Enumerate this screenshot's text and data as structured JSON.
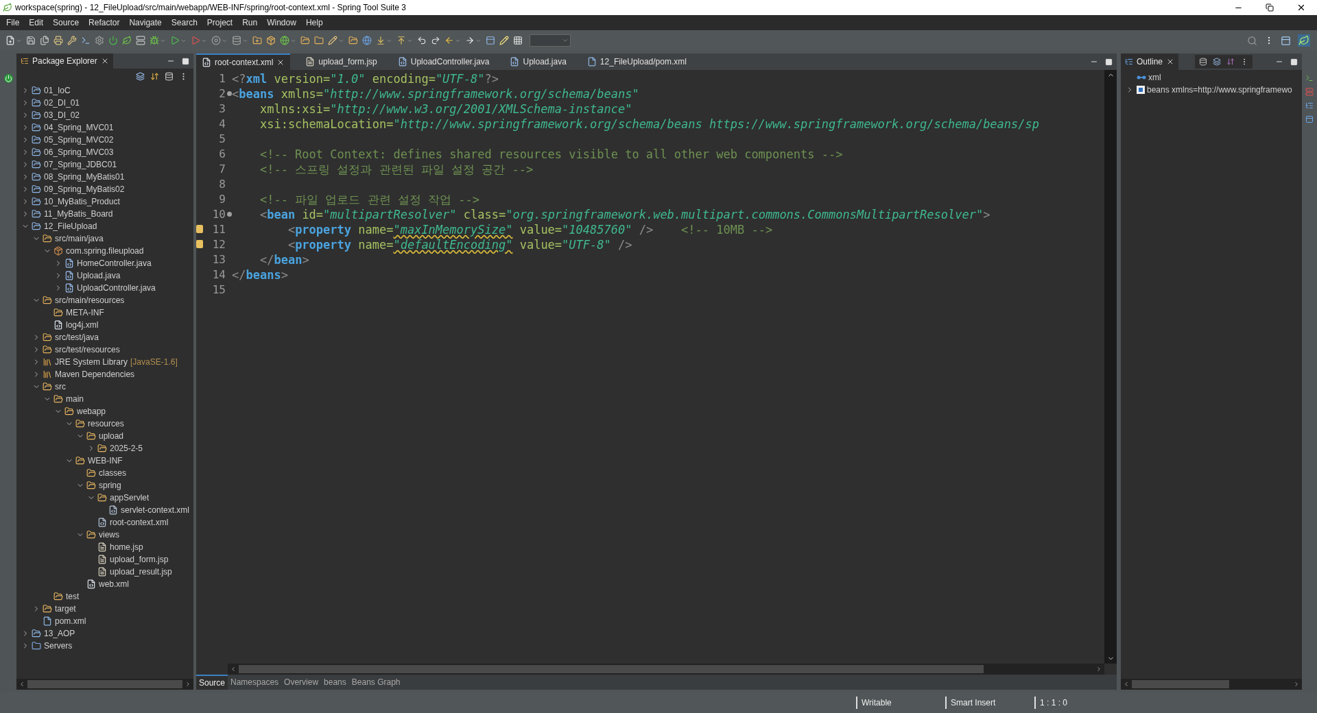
{
  "window": {
    "title": "workspace(spring) - 12_FileUpload/src/main/webapp/WEB-INF/spring/root-context.xml - Spring Tool Suite 3"
  },
  "menu": [
    "File",
    "Edit",
    "Source",
    "Refactor",
    "Navigate",
    "Search",
    "Project",
    "Run",
    "Window",
    "Help"
  ],
  "package_explorer": {
    "title": "Package Explorer",
    "tree": [
      {
        "label": "01_IoC",
        "kind": "project",
        "expanded": false
      },
      {
        "label": "02_DI_01",
        "kind": "project",
        "expanded": false
      },
      {
        "label": "03_DI_02",
        "kind": "project",
        "expanded": false
      },
      {
        "label": "04_Spring_MVC01",
        "kind": "project",
        "expanded": false
      },
      {
        "label": "05_Spring_MVC02",
        "kind": "project",
        "expanded": false
      },
      {
        "label": "06_Spring_MVC03",
        "kind": "project",
        "expanded": false
      },
      {
        "label": "07_Spring_JDBC01",
        "kind": "project",
        "expanded": false
      },
      {
        "label": "08_Spring_MyBatis01",
        "kind": "project",
        "expanded": false
      },
      {
        "label": "09_Spring_MyBatis02",
        "kind": "project",
        "expanded": false
      },
      {
        "label": "10_MyBatis_Product",
        "kind": "project",
        "expanded": false
      },
      {
        "label": "11_MyBatis_Board",
        "kind": "project",
        "expanded": false
      },
      {
        "label": "12_FileUpload",
        "kind": "project",
        "expanded": true,
        "children": [
          {
            "label": "src/main/java",
            "kind": "srcfolder",
            "expanded": true,
            "children": [
              {
                "label": "com.spring.fileupload",
                "kind": "package",
                "expanded": true,
                "children": [
                  {
                    "label": "HomeController.java",
                    "kind": "java",
                    "expanded": false
                  },
                  {
                    "label": "Upload.java",
                    "kind": "java",
                    "expanded": false
                  },
                  {
                    "label": "UploadController.java",
                    "kind": "java",
                    "expanded": false
                  }
                ]
              }
            ]
          },
          {
            "label": "src/main/resources",
            "kind": "srcfolder",
            "expanded": true,
            "children": [
              {
                "label": "META-INF",
                "kind": "folder"
              },
              {
                "label": "log4j.xml",
                "kind": "xml"
              }
            ]
          },
          {
            "label": "src/test/java",
            "kind": "srcfolder",
            "expanded": false
          },
          {
            "label": "src/test/resources",
            "kind": "srcfolder",
            "expanded": false
          },
          {
            "label": "JRE System Library",
            "suffix": "[JavaSE-1.6]",
            "kind": "library",
            "expanded": false
          },
          {
            "label": "Maven Dependencies",
            "kind": "library",
            "expanded": false
          },
          {
            "label": "src",
            "kind": "folder",
            "expanded": true,
            "children": [
              {
                "label": "main",
                "kind": "folder",
                "expanded": true,
                "children": [
                  {
                    "label": "webapp",
                    "kind": "folder",
                    "expanded": true,
                    "children": [
                      {
                        "label": "resources",
                        "kind": "folder",
                        "expanded": true,
                        "children": [
                          {
                            "label": "upload",
                            "kind": "folder",
                            "expanded": true,
                            "children": [
                              {
                                "label": "2025-2-5",
                                "kind": "folder",
                                "expanded": false
                              }
                            ]
                          }
                        ]
                      },
                      {
                        "label": "WEB-INF",
                        "kind": "folder",
                        "expanded": true,
                        "children": [
                          {
                            "label": "classes",
                            "kind": "folder"
                          },
                          {
                            "label": "spring",
                            "kind": "folder",
                            "expanded": true,
                            "children": [
                              {
                                "label": "appServlet",
                                "kind": "folder",
                                "expanded": true,
                                "children": [
                                  {
                                    "label": "servlet-context.xml",
                                    "kind": "springxml"
                                  }
                                ]
                              },
                              {
                                "label": "root-context.xml",
                                "kind": "springxml"
                              }
                            ]
                          },
                          {
                            "label": "views",
                            "kind": "folder",
                            "expanded": true,
                            "children": [
                              {
                                "label": "home.jsp",
                                "kind": "jsp"
                              },
                              {
                                "label": "upload_form.jsp",
                                "kind": "jsp"
                              },
                              {
                                "label": "upload_result.jsp",
                                "kind": "jsp"
                              }
                            ]
                          },
                          {
                            "label": "web.xml",
                            "kind": "xml"
                          }
                        ]
                      }
                    ]
                  }
                ]
              },
              {
                "label": "test",
                "kind": "folder"
              }
            ]
          },
          {
            "label": "target",
            "kind": "folder",
            "expanded": false
          },
          {
            "label": "pom.xml",
            "kind": "pom"
          }
        ]
      },
      {
        "label": "13_AOP",
        "kind": "project",
        "expanded": false
      },
      {
        "label": "Servers",
        "kind": "servers",
        "expanded": false
      }
    ]
  },
  "editor": {
    "tabs": [
      {
        "label": "root-context.xml",
        "kind": "xml",
        "selected": true
      },
      {
        "label": "upload_form.jsp",
        "kind": "jsp",
        "selected": false
      },
      {
        "label": "UploadController.java",
        "kind": "java",
        "selected": false
      },
      {
        "label": "Upload.java",
        "kind": "java",
        "selected": false
      },
      {
        "label": "12_FileUpload/pom.xml",
        "kind": "pom",
        "selected": false
      }
    ],
    "lines": [
      {
        "number": "1",
        "kind": "plain",
        "tokens": [
          {
            "kind": "punct",
            "text": "<?"
          },
          {
            "kind": "tag",
            "text": "xml"
          },
          {
            "kind": "attr",
            "text": " version="
          },
          {
            "kind": "value",
            "text": "\"1.0\""
          },
          {
            "kind": "attr",
            "text": " encoding="
          },
          {
            "kind": "value",
            "text": "\"UTF-8\""
          },
          {
            "kind": "punct",
            "text": "?>"
          }
        ]
      },
      {
        "number": "2",
        "kind": "fold",
        "tokens": [
          {
            "kind": "punct",
            "text": "<"
          },
          {
            "kind": "tag",
            "text": "beans"
          },
          {
            "kind": "attr",
            "text": " xmlns="
          },
          {
            "kind": "value",
            "text": "\"http://www.springframework.org/schema/beans\""
          }
        ]
      },
      {
        "number": "3",
        "kind": "plain",
        "tokens": [
          {
            "kind": "attr",
            "text": "    xmlns:xsi="
          },
          {
            "kind": "value",
            "text": "\"http://www.w3.org/2001/XMLSchema-instance\""
          }
        ]
      },
      {
        "number": "4",
        "kind": "plain",
        "tokens": [
          {
            "kind": "attr",
            "text": "    xsi:schemaLocation="
          },
          {
            "kind": "value",
            "text": "\"http://www.springframework.org/schema/beans https://www.springframework.org/schema/beans/sp"
          }
        ]
      },
      {
        "number": "5",
        "kind": "plain"
      },
      {
        "number": "6",
        "kind": "plain",
        "tokens": [
          {
            "kind": "comment",
            "text": "    <!-- Root Context: defines shared resources visible to all other web components -->"
          }
        ]
      },
      {
        "number": "7",
        "kind": "plain",
        "tokens": [
          {
            "kind": "comment",
            "text": "    <!-- 스프링 설정과 관련된 파일 설정 공간 -->"
          }
        ]
      },
      {
        "number": "8",
        "kind": "plain"
      },
      {
        "number": "9",
        "kind": "plain",
        "tokens": [
          {
            "kind": "comment",
            "text": "    <!-- 파일 업로드 관련 설정 작업 -->"
          }
        ]
      },
      {
        "number": "10",
        "kind": "fold",
        "tokens": [
          {
            "kind": "punct",
            "text": "    <"
          },
          {
            "kind": "tag",
            "text": "bean"
          },
          {
            "kind": "attr",
            "text": " id="
          },
          {
            "kind": "value",
            "text": "\"multipartResolver\""
          },
          {
            "kind": "attr",
            "text": " class="
          },
          {
            "kind": "value",
            "text": "\"org.springframework.web.multipart.commons.CommonsMultipartResolver\""
          },
          {
            "kind": "punct",
            "text": ">"
          }
        ]
      },
      {
        "number": "11",
        "kind": "warning",
        "tokens": [
          {
            "kind": "punct",
            "text": "        <"
          },
          {
            "kind": "tag",
            "text": "property"
          },
          {
            "kind": "attr",
            "text": " name="
          },
          {
            "kind": "flagged",
            "text": "\"maxInMemorySize\""
          },
          {
            "kind": "attr",
            "text": " value="
          },
          {
            "kind": "value",
            "text": "\"10485760\""
          },
          {
            "kind": "punct",
            "text": " />"
          },
          {
            "kind": "comment",
            "text": "    <!-- 10MB -->"
          }
        ]
      },
      {
        "number": "12",
        "kind": "warning",
        "tokens": [
          {
            "kind": "punct",
            "text": "        <"
          },
          {
            "kind": "tag",
            "text": "property"
          },
          {
            "kind": "attr",
            "text": " name="
          },
          {
            "kind": "flagged",
            "text": "\"defaultEncoding\""
          },
          {
            "kind": "attr",
            "text": " value="
          },
          {
            "kind": "value",
            "text": "\"UTF-8\""
          },
          {
            "kind": "punct",
            "text": " />"
          }
        ]
      },
      {
        "number": "13",
        "kind": "plain",
        "tokens": [
          {
            "kind": "punct",
            "text": "    </"
          },
          {
            "kind": "tag",
            "text": "bean"
          },
          {
            "kind": "punct",
            "text": ">"
          }
        ]
      },
      {
        "number": "14",
        "kind": "plain",
        "tokens": [
          {
            "kind": "punct",
            "text": "</"
          },
          {
            "kind": "tag",
            "text": "beans"
          },
          {
            "kind": "punct",
            "text": ">"
          }
        ]
      },
      {
        "number": "15",
        "kind": "plain"
      }
    ],
    "bottom_tabs": [
      {
        "label": "Source",
        "selected": true
      },
      {
        "label": "Namespaces",
        "selected": false
      },
      {
        "label": "Overview",
        "selected": false
      },
      {
        "label": "beans",
        "selected": false
      },
      {
        "label": "Beans Graph",
        "selected": false
      }
    ]
  },
  "outline": {
    "title": "Outline",
    "items": [
      {
        "label": "xml",
        "kind": "pi"
      },
      {
        "label": "beans xmlns=http://www.springframewo",
        "kind": "element",
        "expanded": false
      }
    ]
  },
  "status_bar": [
    "Writable",
    "Smart Insert",
    "1 : 1 : 0"
  ]
}
